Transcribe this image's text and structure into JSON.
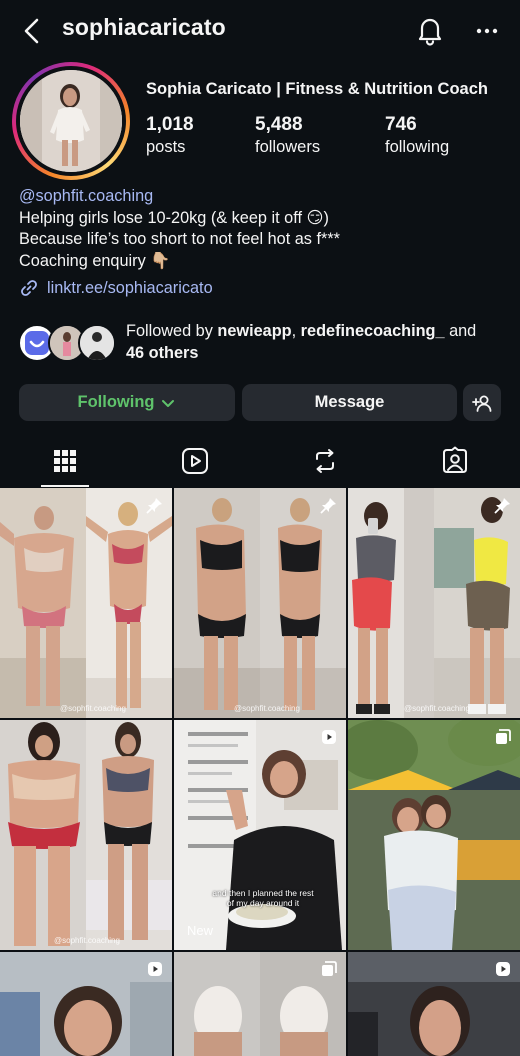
{
  "header": {
    "username": "sophiacaricato",
    "back_icon": "chevron-left-icon",
    "bell_icon": "bell-icon",
    "more_icon": "more-horizontal-icon"
  },
  "profile": {
    "display_name": "Sophia Caricato | Fitness & Nutrition Coach",
    "stats": [
      {
        "value": "1,018",
        "label": "posts"
      },
      {
        "value": "5,488",
        "label": "followers"
      },
      {
        "value": "746",
        "label": "following"
      }
    ]
  },
  "bio": {
    "handle": "@sophfit.coaching",
    "line1": "Helping girls lose 10-20kg (& keep it off 😏)",
    "line2": "Because life’s too short to not feel hot as f***",
    "line3": "Coaching enquiry 👇🏼",
    "link": "linktr.ee/sophiacaricato"
  },
  "followed_by": {
    "prefix": "Followed by ",
    "user1": "newieapp",
    "sep": ", ",
    "user2": "redefinecoaching_",
    "and": " and",
    "others": "46 others"
  },
  "actions": {
    "following_label": "Following",
    "message_label": "Message"
  },
  "tabs": [
    "grid-icon",
    "reels-icon",
    "reposts-icon",
    "tagged-icon"
  ],
  "grid": {
    "captions": {
      "t1": "@sophfit.coaching",
      "t2": "@sophfit.coaching",
      "t3": "@sophfit.coaching",
      "t4": "@sophfit.coaching",
      "t5_overlay": "and then I planned the rest of my day around it",
      "t5_new": "New"
    }
  },
  "colors": {
    "background": "#0c1014",
    "link": "#a8b9f3",
    "following_green": "#5fc36b",
    "button_bg": "#262a30"
  }
}
